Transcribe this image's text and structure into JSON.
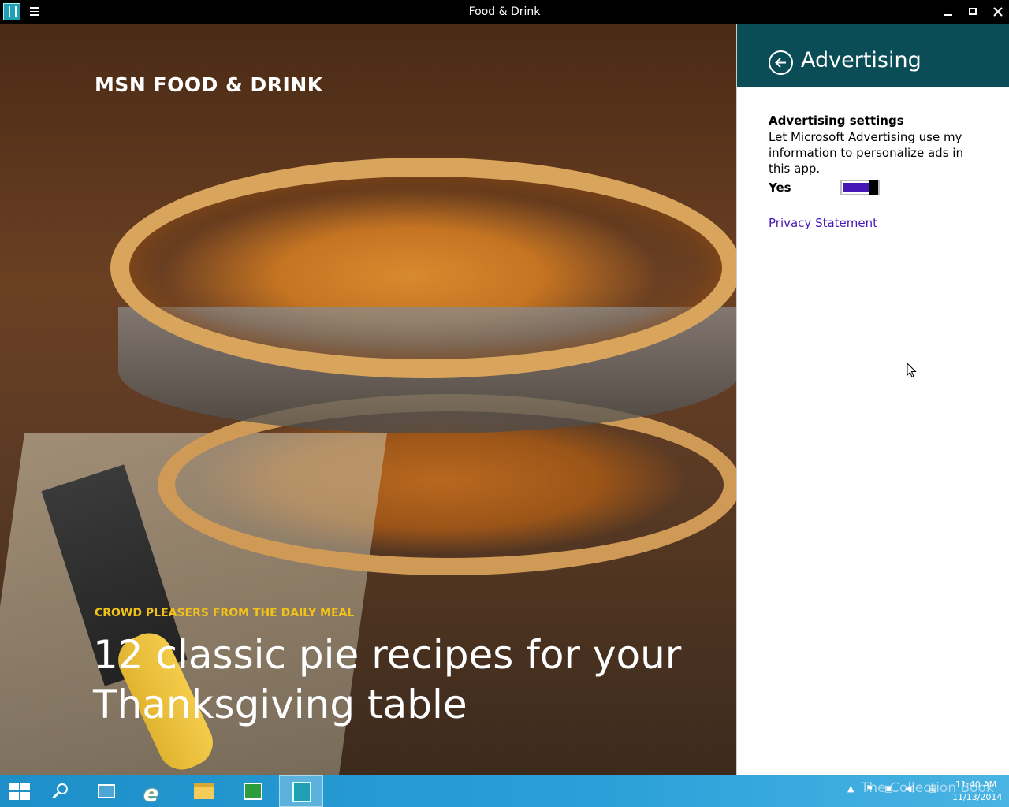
{
  "window": {
    "title": "Food & Drink"
  },
  "hero": {
    "brand": "MSN FOOD & DRINK",
    "kicker": "CROWD PLEASERS FROM THE DAILY MEAL",
    "headline_line1": "12 classic pie recipes for your",
    "headline_line2": "Thanksgiving table"
  },
  "panel": {
    "title": "Advertising",
    "settings_heading": "Advertising settings",
    "settings_description": "Let Microsoft Advertising use my information to personalize ads in this app.",
    "toggle_label": "Yes",
    "privacy_link": "Privacy Statement",
    "accent_color": "#4617b4",
    "header_color": "#0b4d56"
  },
  "taskbar": {
    "clock_time": "11:40 AM",
    "clock_date": "11/13/2014",
    "watermark": "The Collection Book",
    "ie_glyph": "e"
  }
}
